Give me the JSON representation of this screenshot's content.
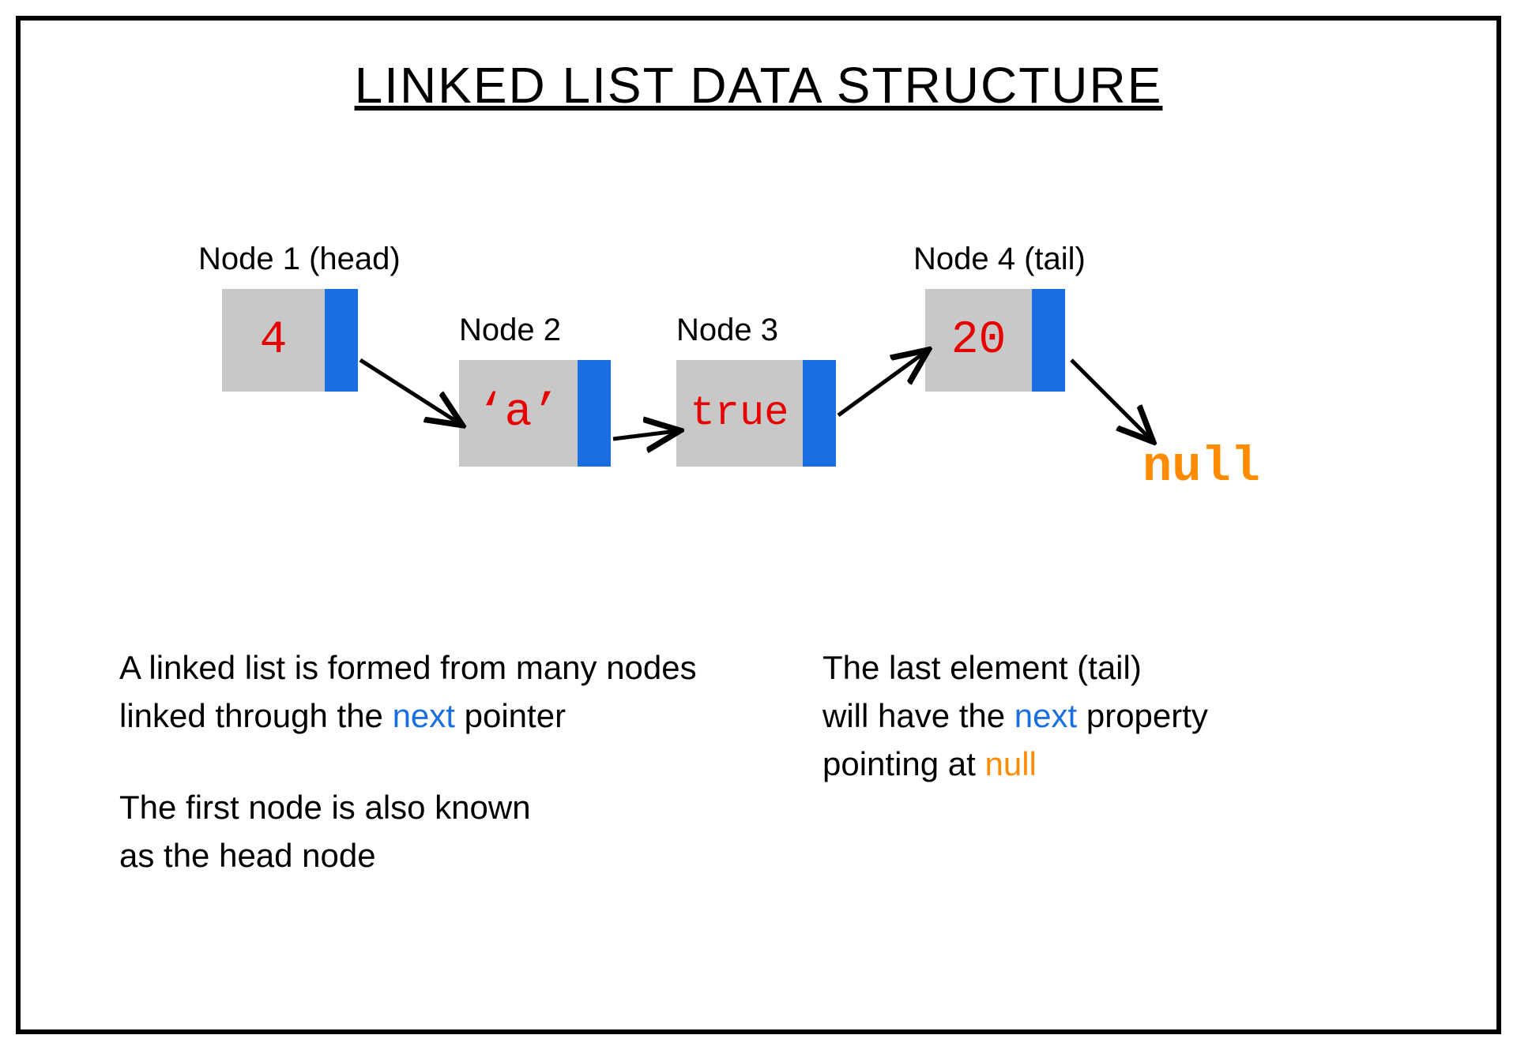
{
  "title": "LINKED LIST DATA STRUCTURE",
  "nodes": [
    {
      "label": "Node 1 (head)",
      "value": "4"
    },
    {
      "label": "Node 2",
      "value": "‘a’"
    },
    {
      "label": "Node 3",
      "value": "true"
    },
    {
      "label": "Node 4 (tail)",
      "value": "20"
    }
  ],
  "null_label": "null",
  "description_left": {
    "line1": "A linked list is formed from many nodes",
    "line2a": "linked through the ",
    "line2b_keyword": "next",
    "line2c": " pointer",
    "line3": "The first node is also known",
    "line4": "as the head node"
  },
  "description_right": {
    "line1": "The last element (tail)",
    "line2a": "will have the ",
    "line2b_keyword": "next",
    "line2c": " property",
    "line3a": "pointing at ",
    "line3b_keyword": "null"
  },
  "colors": {
    "node_fill": "#c8c8c8",
    "pointer_fill": "#1a6fe0",
    "value_color": "#e60000",
    "null_color": "#ff8c00",
    "text_color": "#000000"
  }
}
